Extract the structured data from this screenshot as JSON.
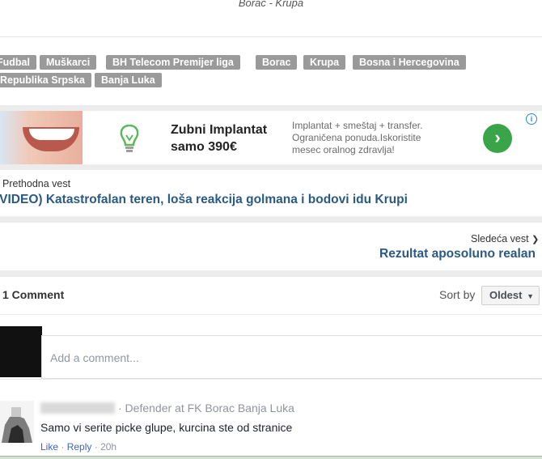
{
  "header": {
    "caption": "Borac - Krupa"
  },
  "tags": [
    "Fudbal",
    "Muškarci",
    "BH Telecom Premijer liga",
    "Borac",
    "Krupa",
    "Bosna i Hercegovina",
    "Republika Srpska",
    "Banja Luka"
  ],
  "ad": {
    "title_line1": "Zubni Implantat",
    "title_line2": "samo 390€",
    "text_line1": "Implantat + smeštaj + transfer.",
    "text_line2": "Ograničena ponuda.Iskoristite",
    "text_line3": "mesec oralnog zdravlja!",
    "button_glyph": "›",
    "info_glyph": "i",
    "colors": {
      "button": "#3aa548",
      "info": "#2a8ad8"
    }
  },
  "prev": {
    "label": "Prethodna vest",
    "title": "(VIDEO) Katastrofalan teren, loša reakcija golmana i bodovi idu Krupi"
  },
  "next": {
    "label": "Sledeća vest",
    "arrow": "❯",
    "title": "Rezultat aposoluno realan"
  },
  "comments": {
    "heading": "1 Comment",
    "sort_label": "Sort by",
    "sort_value": "Oldest",
    "sort_caret": "▼",
    "input_placeholder": "Add a comment...",
    "items": [
      {
        "affiliation": "· Defender at FK Borac Banja Luka",
        "text": "Samo vi serite picke glupe, kurcina ste od stranice",
        "like": "Like",
        "reply": "Reply",
        "time": "· 20h"
      }
    ]
  },
  "colors": {
    "tag_bg": "#9a9a9a",
    "link": "#2a5a82",
    "fb_link": "#4267b2"
  }
}
